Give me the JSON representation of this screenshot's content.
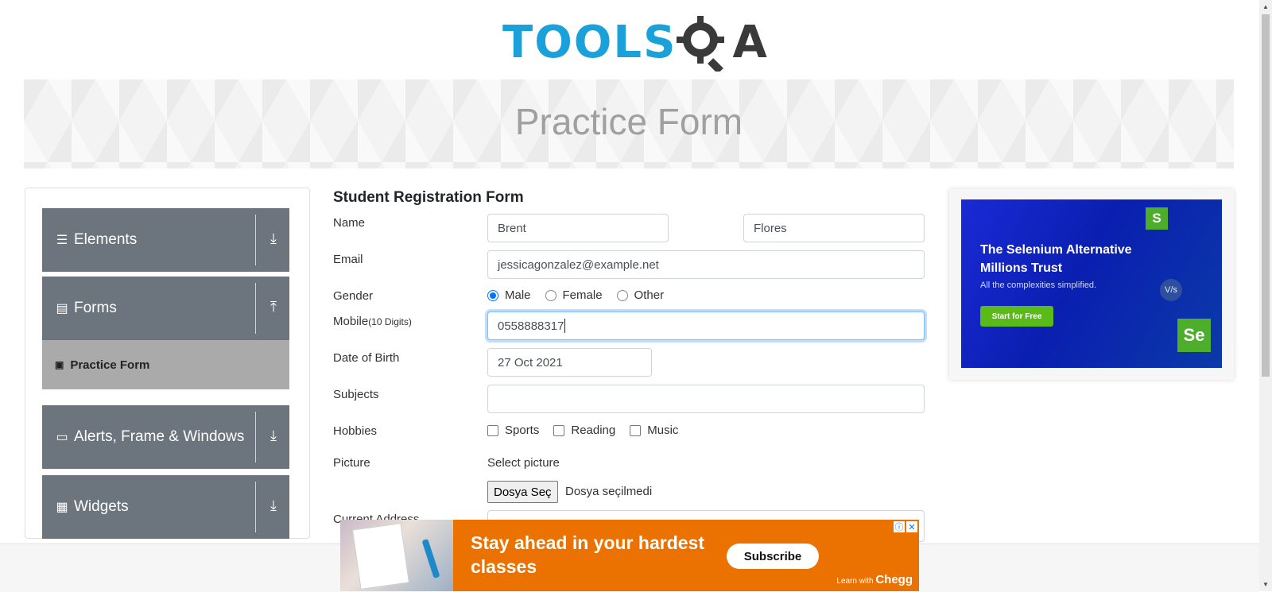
{
  "logo": {
    "part1": "TOOLS",
    "part2": "A"
  },
  "page_title": "Practice Form",
  "sidebar": {
    "groups": [
      {
        "label": "Elements",
        "icon": "hamburger-icon",
        "arrow": "download-icon"
      },
      {
        "label": "Forms",
        "icon": "document-icon",
        "arrow": "upload-icon"
      },
      {
        "label": "Alerts, Frame & Windows",
        "icon": "window-icon",
        "arrow": "download-icon"
      },
      {
        "label": "Widgets",
        "icon": "widgets-icon",
        "arrow": "download-icon"
      }
    ],
    "active_item": "Practice Form"
  },
  "form": {
    "heading": "Student Registration Form",
    "name_label": "Name",
    "first_name": "Brent",
    "last_name": "Flores",
    "email_label": "Email",
    "email": "jessicagonzalez@example.net",
    "gender_label": "Gender",
    "gender_options": [
      "Male",
      "Female",
      "Other"
    ],
    "gender_selected": "Male",
    "mobile_label": "Mobile",
    "mobile_hint": "(10 Digits)",
    "mobile": "0558888317",
    "dob_label": "Date of Birth",
    "dob": "27 Oct 2021",
    "subjects_label": "Subjects",
    "subjects": "",
    "hobbies_label": "Hobbies",
    "hobbies": [
      "Sports",
      "Reading",
      "Music"
    ],
    "picture_label": "Picture",
    "select_picture": "Select picture",
    "file_button": "Dosya Seç",
    "file_status": "Dosya seçilmedi",
    "address_label": "Current Address"
  },
  "ad_right": {
    "headline": "The Selenium Alternative Millions Trust",
    "tagline": "All the complexities simplified.",
    "cta": "Start for Free",
    "badge_s": "S",
    "vs": "V/s",
    "badge_se": "Se"
  },
  "ad_bottom": {
    "headline": "Stay ahead in your hardest classes",
    "cta": "Subscribe",
    "brand_prefix": "Learn with",
    "brand": "Chegg",
    "info": "ⓘ",
    "close": "✕"
  },
  "colors": {
    "accent": "#1aa1d9",
    "sidebar": "#6c757d",
    "chegg": "#eb7100",
    "radio": "#0075ff"
  }
}
